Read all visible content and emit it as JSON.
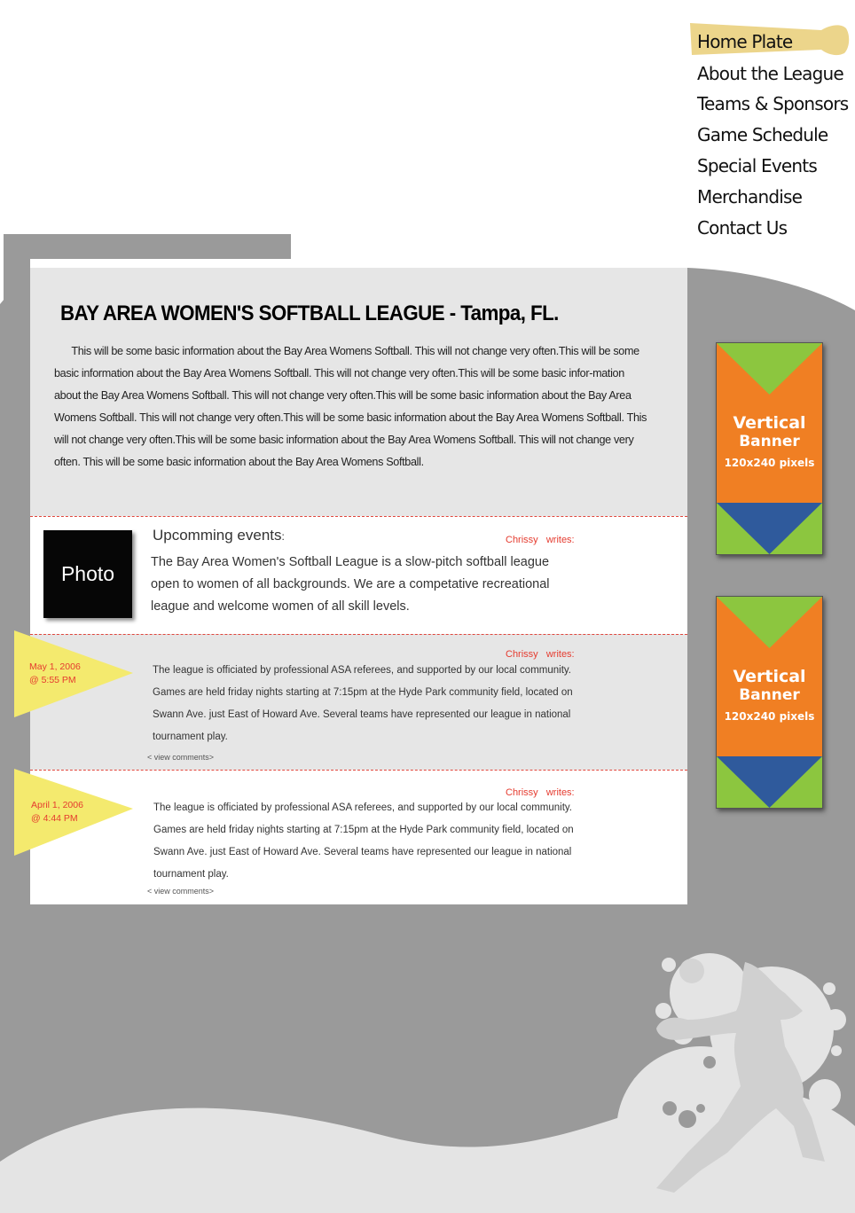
{
  "nav": {
    "items": [
      "Home Plate",
      "About the League",
      "Teams & Sponsors",
      "Game Schedule",
      "Special Events",
      "Merchandise",
      "Contact Us"
    ],
    "active": "Home Plate"
  },
  "header": {
    "title": "BAY AREA  WOMEN'S  SOFTBALL LEAGUE - Tampa, FL.",
    "intro": "This will be some basic information about the Bay Area Womens Softball.  This will not change very often.This will be some basic information about the Bay Area Womens Softball.  This will not change very often.This will be some basic infor-mation about the Bay Area Womens Softball.  This will not change very often.This will be some basic information about the Bay Area Womens Softball.  This will not change very often.This will be some basic information about the Bay Area Womens Softball.  This will not change very often.This will be some basic information about the Bay Area Womens Softball.  This will not change very often. This will be some basic information about the Bay Area Womens Softball."
  },
  "events": {
    "photo_label": "Photo",
    "heading": "Upcomming events",
    "heading_colon": ":",
    "author_line": "Chrissy   writes:",
    "body": "The Bay Area Women's Softball League is a slow-pitch softball league open to women of all backgrounds. We are a competative recreational league and welcome women of all skill levels."
  },
  "posts": [
    {
      "date": "May 1, 2006",
      "time": "@ 5:55 PM",
      "author_line": "Chrissy   writes:",
      "body": "The league is officiated by professional ASA referees, and supported by our local community. Games are held friday nights starting at 7:15pm at the Hyde Park community field, located on Swann Ave. just East of Howard Ave. Several teams have represented our league in national tournament play.",
      "comments_link": "< view comments>"
    },
    {
      "date": "April 1, 2006",
      "time": "@ 4:44 PM",
      "author_line": "Chrissy   writes:",
      "body": "The league is officiated by professional ASA referees, and supported by our local community. Games are held friday nights starting at 7:15pm at the Hyde Park community field, located on Swann Ave. just East of Howard Ave. Several teams have represented our league in national tournament play.",
      "comments_link": "< view comments>"
    }
  ],
  "banners": [
    {
      "line1": "Vertical",
      "line2": "Banner",
      "size": "120x240 pixels"
    },
    {
      "line1": "Vertical",
      "line2": "Banner",
      "size": "120x240 pixels"
    }
  ],
  "colors": {
    "page_gray": "#9a9a9a",
    "light_gray": "#e6e6e6",
    "accent_red": "#e53b2f",
    "pennant_yellow": "#f4ea6e",
    "bat_tan": "#ecd58b",
    "banner_orange": "#f07f23",
    "banner_green": "#8cc63f",
    "banner_blue": "#2f5a9c"
  },
  "icons": {
    "decoration": "softball-pitcher-silhouette",
    "nav_marker": "softball-bat-icon",
    "date_marker": "pennant-icon"
  }
}
